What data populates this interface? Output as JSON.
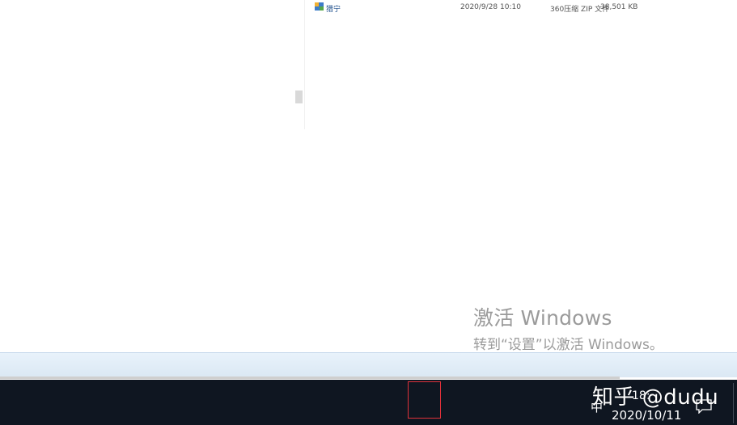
{
  "file_list": {
    "row": {
      "name": "猎宁",
      "date": "2020/9/28 10:10",
      "type": "360压缩 ZIP 文件",
      "size": "38,501 KB"
    }
  },
  "activation": {
    "title": "激活 Windows",
    "message": "转到“设置”以激活 Windows。"
  },
  "taskbar": {
    "ime": "中",
    "time": "18:",
    "date": "2020/10/11"
  },
  "watermark": "知乎 @dudu",
  "colors": {
    "taskbar_bg": "#0f1621",
    "highlight_box": "#e0313a",
    "activation_text": "#9a9a9a"
  },
  "icons": [
    "people-icon",
    "show-hidden-icons-chevron",
    "media-player-tray-icon",
    "java-tray-icon",
    "feishu-tray-icon",
    "qq-tray-icon",
    "battery-icon",
    "wifi-icon",
    "volume-icon",
    "action-center-icon"
  ]
}
